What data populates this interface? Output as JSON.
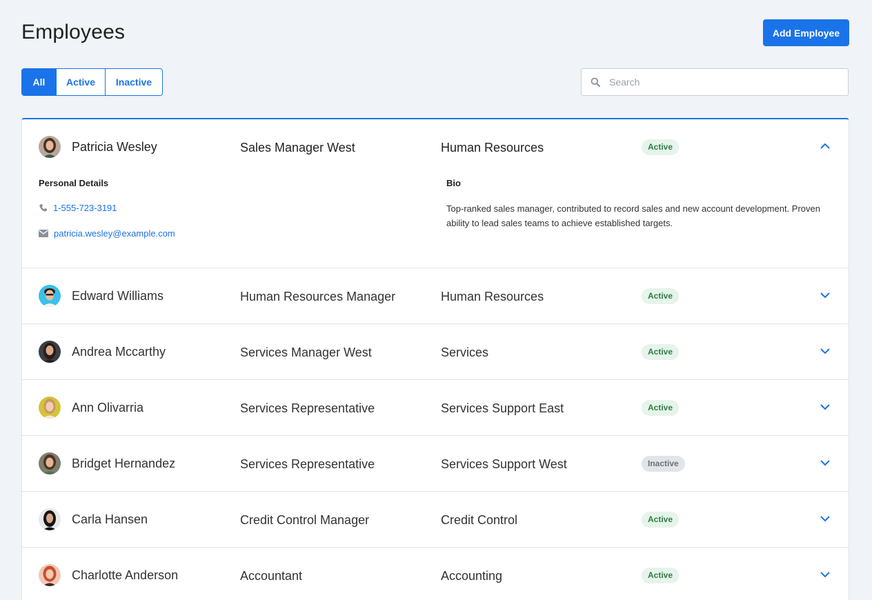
{
  "page": {
    "title": "Employees",
    "add_button": "Add Employee"
  },
  "filters": [
    {
      "label": "All",
      "selected": true
    },
    {
      "label": "Active",
      "selected": false
    },
    {
      "label": "Inactive",
      "selected": false
    }
  ],
  "search": {
    "placeholder": "Search",
    "value": ""
  },
  "colors": {
    "accent": "#1a73e8",
    "active_bg": "#e6f4ea",
    "active_fg": "#2e7d46",
    "inactive_bg": "#e1e4e8",
    "inactive_fg": "#6b7178"
  },
  "employees": [
    {
      "name": "Patricia Wesley",
      "title": "Sales Manager West",
      "department": "Human Resources",
      "status": "Active",
      "expanded": true,
      "personal_details_label": "Personal Details",
      "phone": "1-555-723-3191",
      "email": "patricia.wesley@example.com",
      "bio_label": "Bio",
      "bio": "Top-ranked sales manager, contributed to record sales and new account development. Proven ability to lead sales teams to achieve established targets."
    },
    {
      "name": "Edward Williams",
      "title": "Human Resources Manager",
      "department": "Human Resources",
      "status": "Active",
      "expanded": false
    },
    {
      "name": "Andrea Mccarthy",
      "title": "Services Manager West",
      "department": "Services",
      "status": "Active",
      "expanded": false
    },
    {
      "name": "Ann Olivarria",
      "title": "Services Representative",
      "department": "Services Support East",
      "status": "Active",
      "expanded": false
    },
    {
      "name": "Bridget Hernandez",
      "title": "Services Representative",
      "department": "Services Support West",
      "status": "Inactive",
      "expanded": false
    },
    {
      "name": "Carla Hansen",
      "title": "Credit Control Manager",
      "department": "Credit Control",
      "status": "Active",
      "expanded": false
    },
    {
      "name": "Charlotte Anderson",
      "title": "Accountant",
      "department": "Accounting",
      "status": "Active",
      "expanded": false
    }
  ]
}
